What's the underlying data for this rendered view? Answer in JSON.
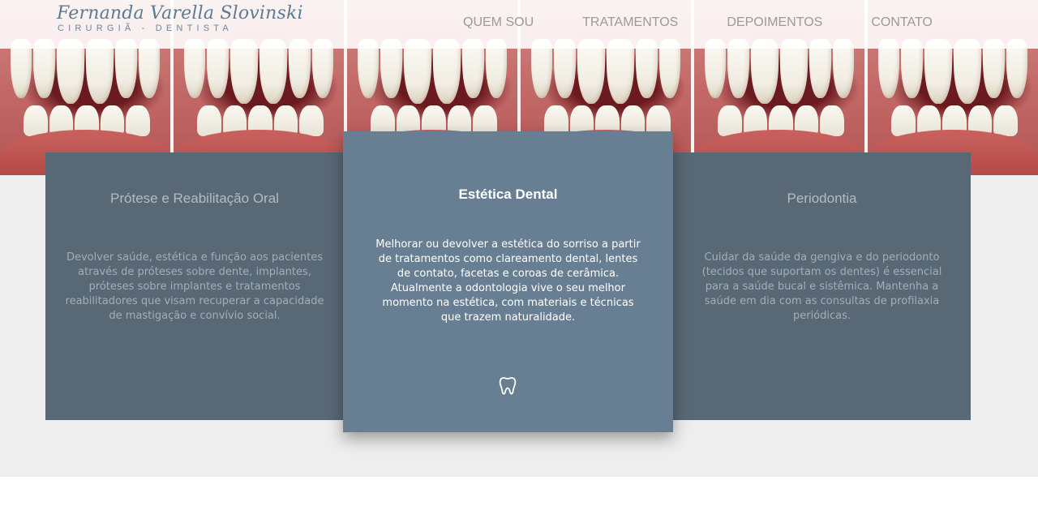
{
  "header": {
    "logo_name": "Fernanda Varella Slovinski",
    "logo_subtitle": "CIRURGIÃ - DENTISTA",
    "nav": [
      "QUEM SOU",
      "TRATAMENTOS",
      "DEPOIMENTOS",
      "CONTATO"
    ]
  },
  "cards": [
    {
      "title": "Prótese e Reabilitação Oral",
      "text": "Devolver saúde, estética e função aos pacientes através de próteses sobre dente, implantes, próteses sobre implantes e tratamentos reabilitadores que visam recuperar a capacidade de mastigação e convívio social."
    },
    {
      "title": "Estética Dental",
      "text": "Melhorar ou devolver a estética do sorriso a partir de tratamentos como clareamento dental, lentes de contato, facetas e coroas de cerâmica. Atualmente a odontologia vive o seu melhor momento na estética, com materiais e técnicas que trazem naturalidade.",
      "icon": "tooth-icon"
    },
    {
      "title": "Periodontia",
      "text": "Cuidar da saúde da gengiva e do periodonto (tecidos que suportam os dentes) é essencial para a saúde bucal e sistêmica. Mantenha a saúde em dia com as consultas de profilaxia periódicas."
    }
  ],
  "colors": {
    "card_dark": "#586874",
    "card_highlight": "#687f93",
    "section_bg": "#eeeeee",
    "logo": "#5d7b92",
    "nav": "#9a9a9a"
  }
}
